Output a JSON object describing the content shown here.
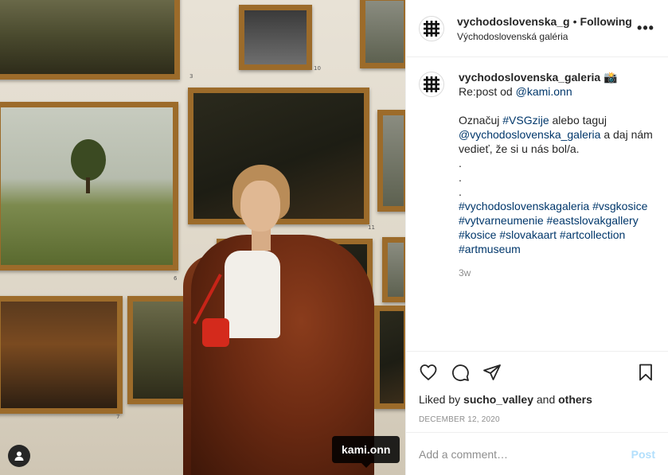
{
  "header": {
    "username": "vychodoslovenska_g",
    "separator": "•",
    "follow_status": "Following",
    "location": "Východoslovenská galéria",
    "more_label": "•••"
  },
  "photo": {
    "tagged_user": "kami.onn",
    "frame_numbers": [
      "3",
      "10",
      "6",
      "11",
      "7"
    ]
  },
  "caption": {
    "username": "vychodoslovenska_galeria",
    "emoji": "📸",
    "line1_rest": " Re:post od ",
    "mention1": "@kami.onn",
    "text_a": "Označuj ",
    "hashtag_vsgzije": "#VSGzije",
    "text_b": " alebo taguj ",
    "mention2": "@vychodoslovenska_galeria",
    "text_c": " a daj nám vedieť, že si u nás bol/a.",
    "dot": ".",
    "hashtags": [
      "#vychodoslovenskagaleria",
      "#vsgkosice",
      "#vytvarneumenie",
      "#eastslovakgallery",
      "#kosice",
      "#slovakaart",
      "#artcollection",
      "#artmuseum"
    ],
    "time": "3w"
  },
  "actions": {
    "icons": [
      "heart-icon",
      "comment-icon",
      "share-icon",
      "bookmark-icon"
    ],
    "liked_by_prefix": "Liked by ",
    "liked_by_user": "sucho_valley",
    "liked_by_and": " and ",
    "liked_by_others": "others",
    "date": "DECEMBER 12, 2020"
  },
  "comment_box": {
    "placeholder": "Add a comment…",
    "post_label": "Post"
  },
  "colors": {
    "link": "#00376b",
    "muted": "#8e8e8e",
    "post_disabled": "#b2dffc",
    "border": "#efefef"
  }
}
